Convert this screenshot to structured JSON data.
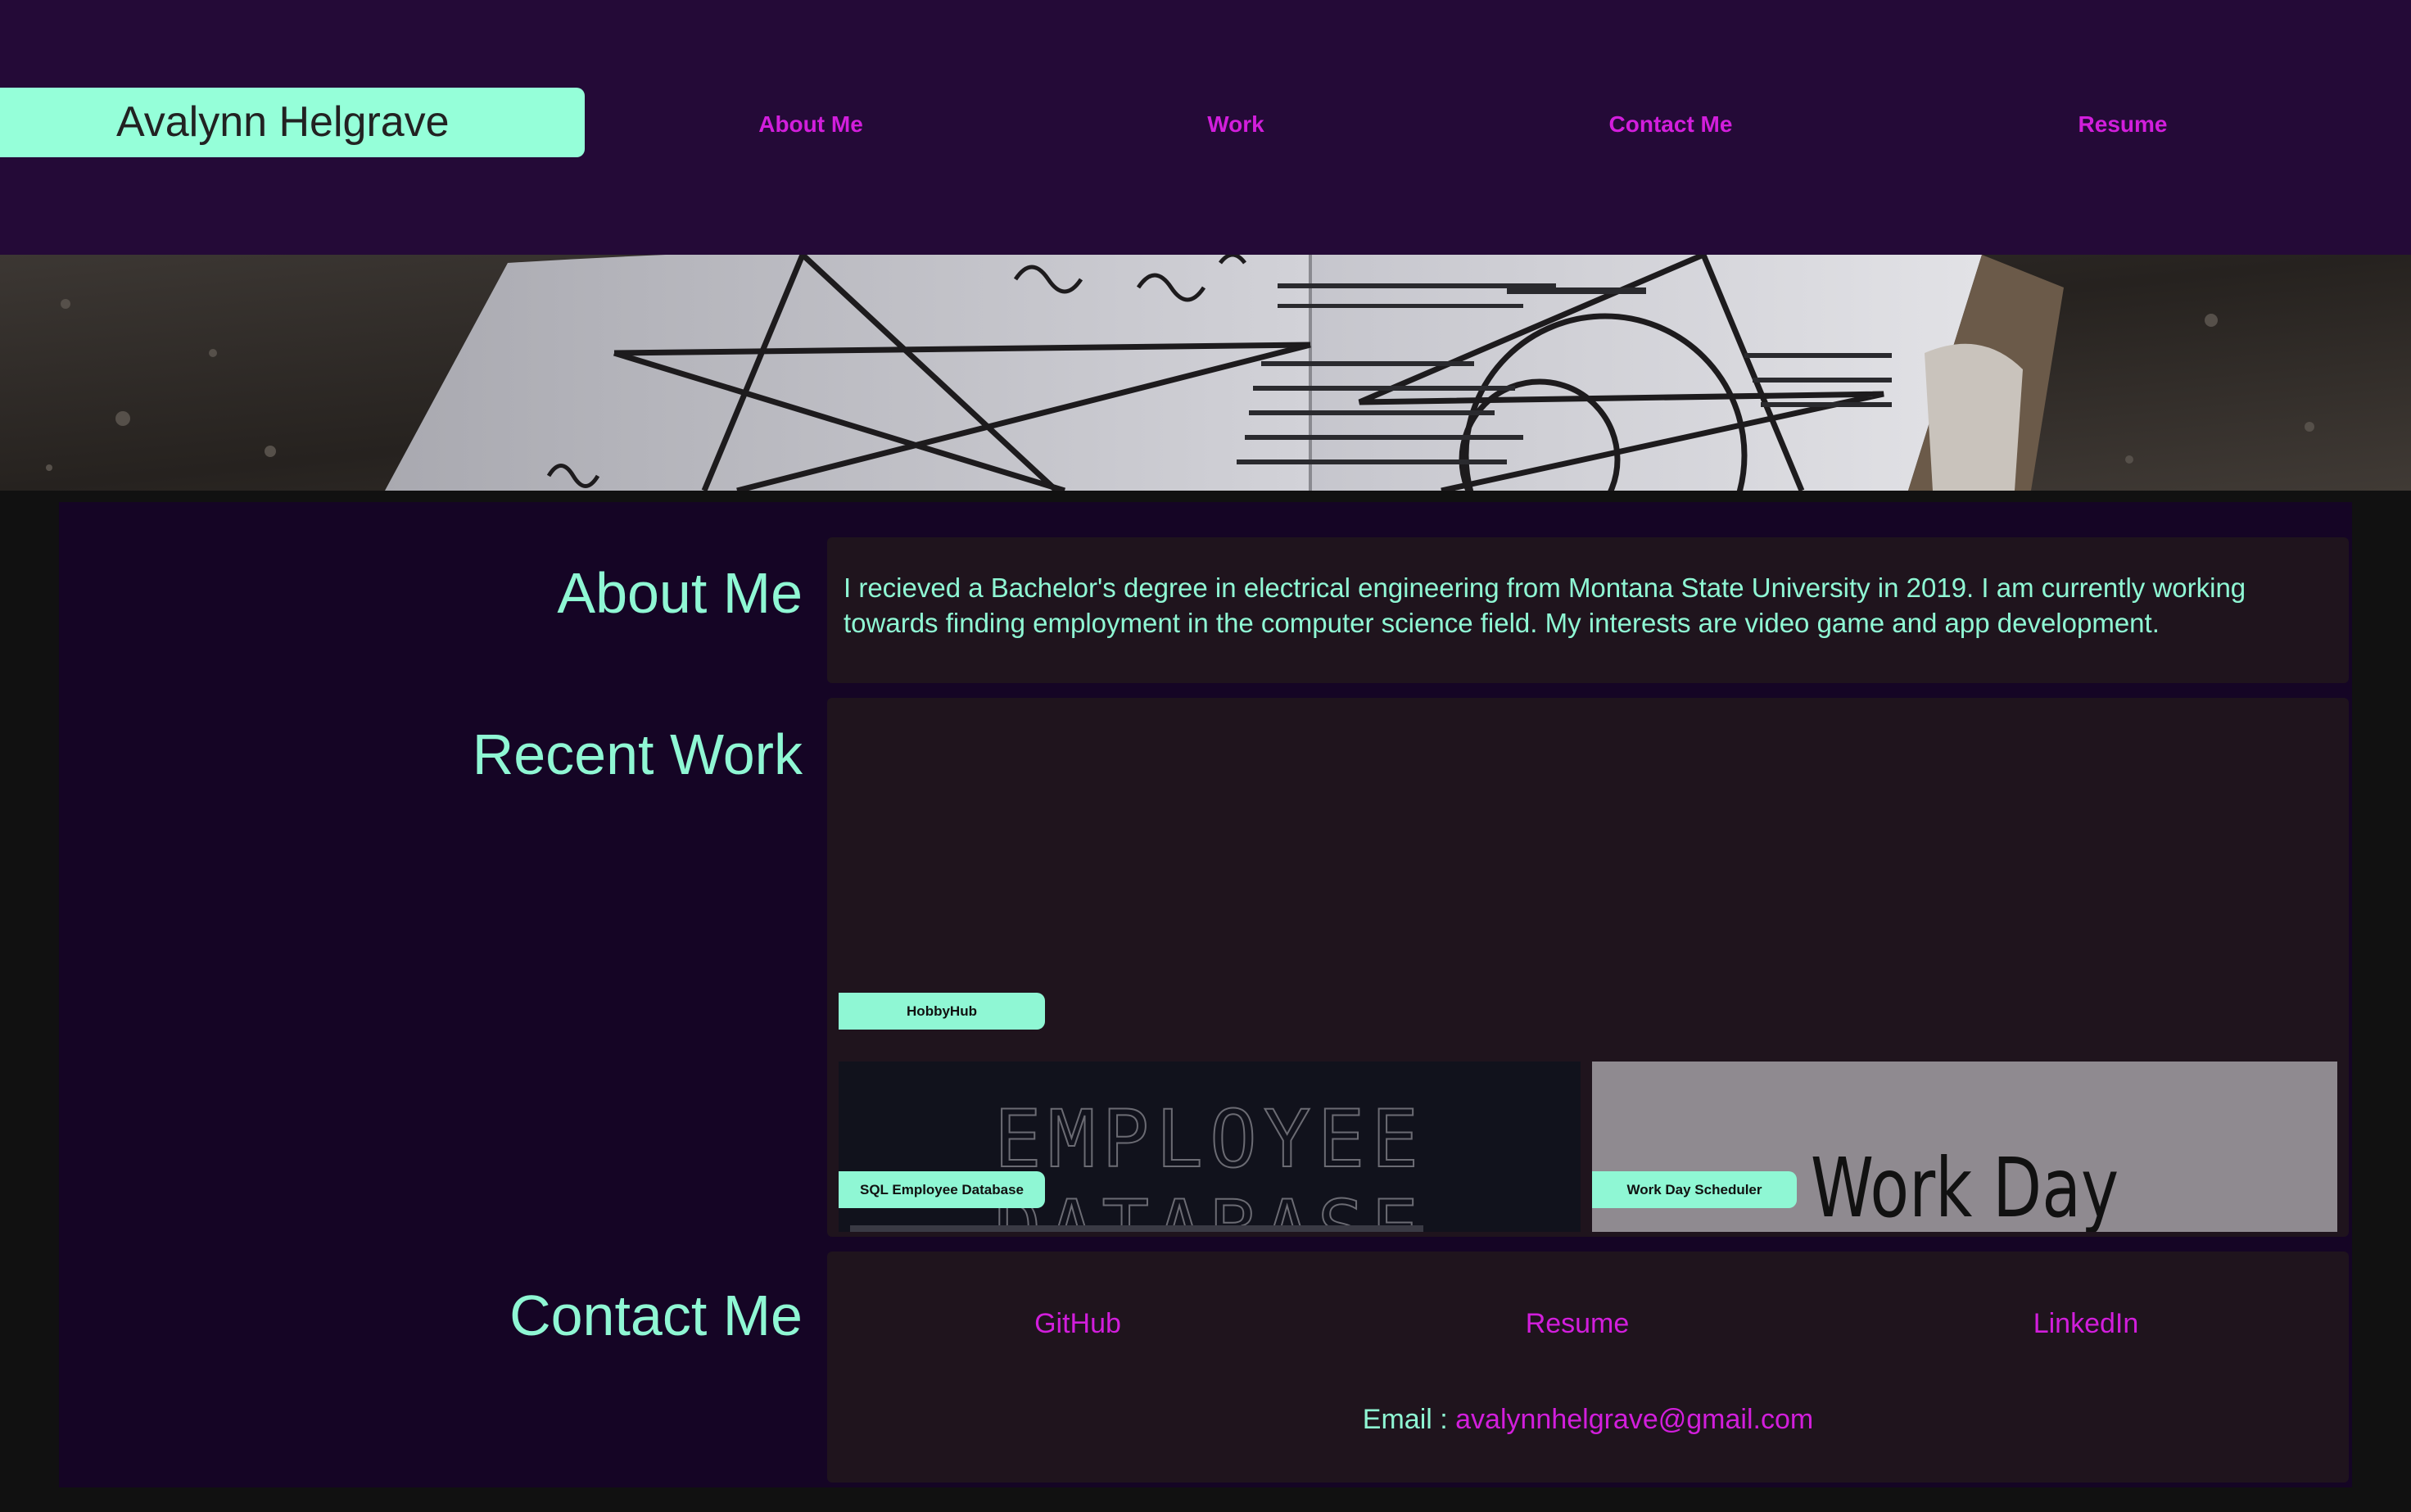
{
  "header": {
    "brand": "Avalynn Helgrave",
    "nav": [
      "About Me",
      "Work",
      "Contact Me",
      "Resume"
    ]
  },
  "about": {
    "title": "About Me",
    "text": "I recieved a Bachelor's degree in electrical engineering from Montana State University in 2019. I am currently working towards finding employment in the computer science field. My interests are video game and app development."
  },
  "work": {
    "title": "Recent Work",
    "featured_label": "HobbyHub",
    "projects": [
      {
        "label": "SQL Employee Database",
        "image_text": "EMPLOYEE DATABASE"
      },
      {
        "label": "Work Day Scheduler",
        "image_text": "Work Day Scheduler"
      }
    ]
  },
  "contact": {
    "title": "Contact Me",
    "links": [
      "GitHub",
      "Resume",
      "LinkedIn"
    ],
    "email_label": "Email : ",
    "email": "avalynnhelgrave@gmail.com"
  },
  "colors": {
    "header_bg": "#240a37",
    "brand_bg": "#95ffd9",
    "accent": "#d21edc",
    "mint": "#8ff7d4",
    "card_bg": "#150525",
    "panel_bg": "#1f141d"
  }
}
